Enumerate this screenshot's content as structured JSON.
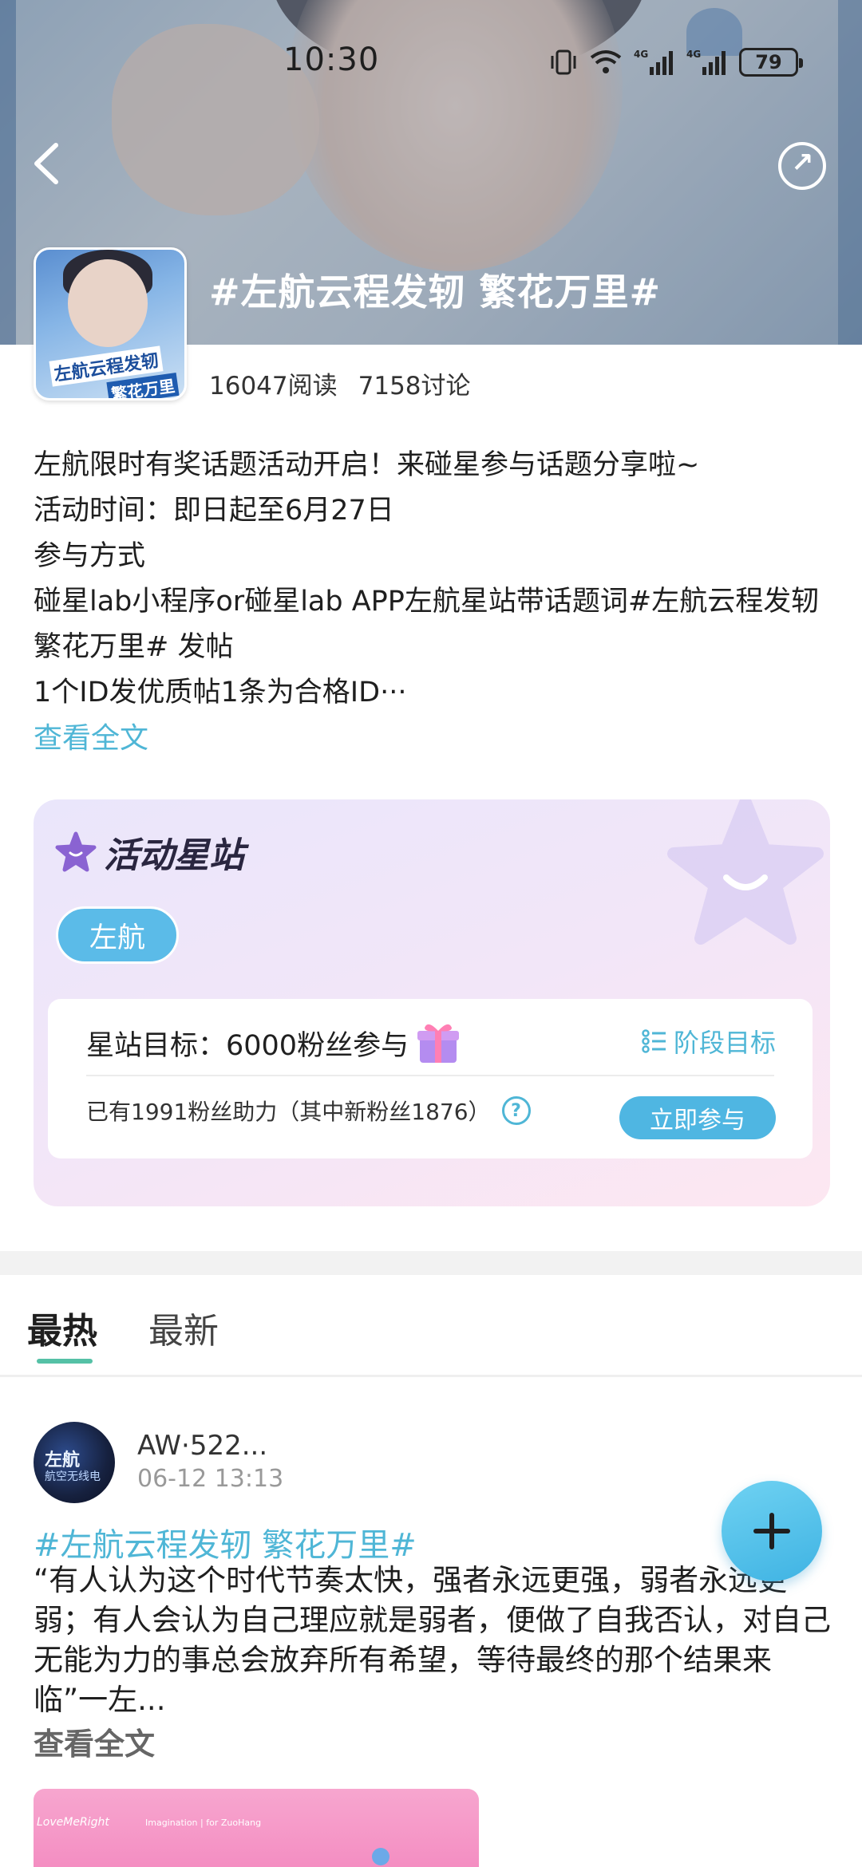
{
  "status_bar": {
    "time": "10:30",
    "battery": "79"
  },
  "topic": {
    "title": "#左航云程发轫 繁花万里#",
    "reads": "16047阅读",
    "discussions": "7158讨论",
    "cover_text_1": "左航云程发轫",
    "cover_text_2": "繁花万里"
  },
  "description": {
    "lines": [
      "左航限时有奖话题活动开启！来碰星参与话题分享啦~",
      "活动时间：即日起至6月27日",
      "参与方式",
      "碰星lab小程序or碰星lab APP左航星站带话题词#左航云程发轫 繁花万里# 发帖",
      "1个ID发优质帖1条为合格ID···"
    ],
    "read_more": "查看全文"
  },
  "activity": {
    "title": "活动星站",
    "tag": "左航",
    "goal_label": "星站目标：6000粉丝参与",
    "stage_label": "阶段目标",
    "fans_text": "已有1991粉丝助力（其中新粉丝1876）",
    "help_icon": "?",
    "join_button": "立即参与"
  },
  "tabs": {
    "hot": "最热",
    "latest": "最新"
  },
  "post": {
    "avatar_text_1": "左航",
    "avatar_text_2": "航空无线电",
    "user_name": "AW·522...",
    "time": "06-12 13:13",
    "tag": "#左航云程发轫 繁花万里#",
    "body": "“有人认为这个时代节奏太快，强者永远更强，弱者永远更弱；有人会认为自己理应就是弱者，便做了自我否认，对自己无能为力的事总会放弃所有希望，等待最终的那个结果来临”一左...",
    "read_more": "查看全文",
    "image_logo": "LoveMeRight",
    "image_sub": "Imagination | for ZuoHang"
  },
  "colors": {
    "accent": "#4fb6d6",
    "tab_indicator": "#55c1a6",
    "join_button": "#4fb6e2"
  }
}
